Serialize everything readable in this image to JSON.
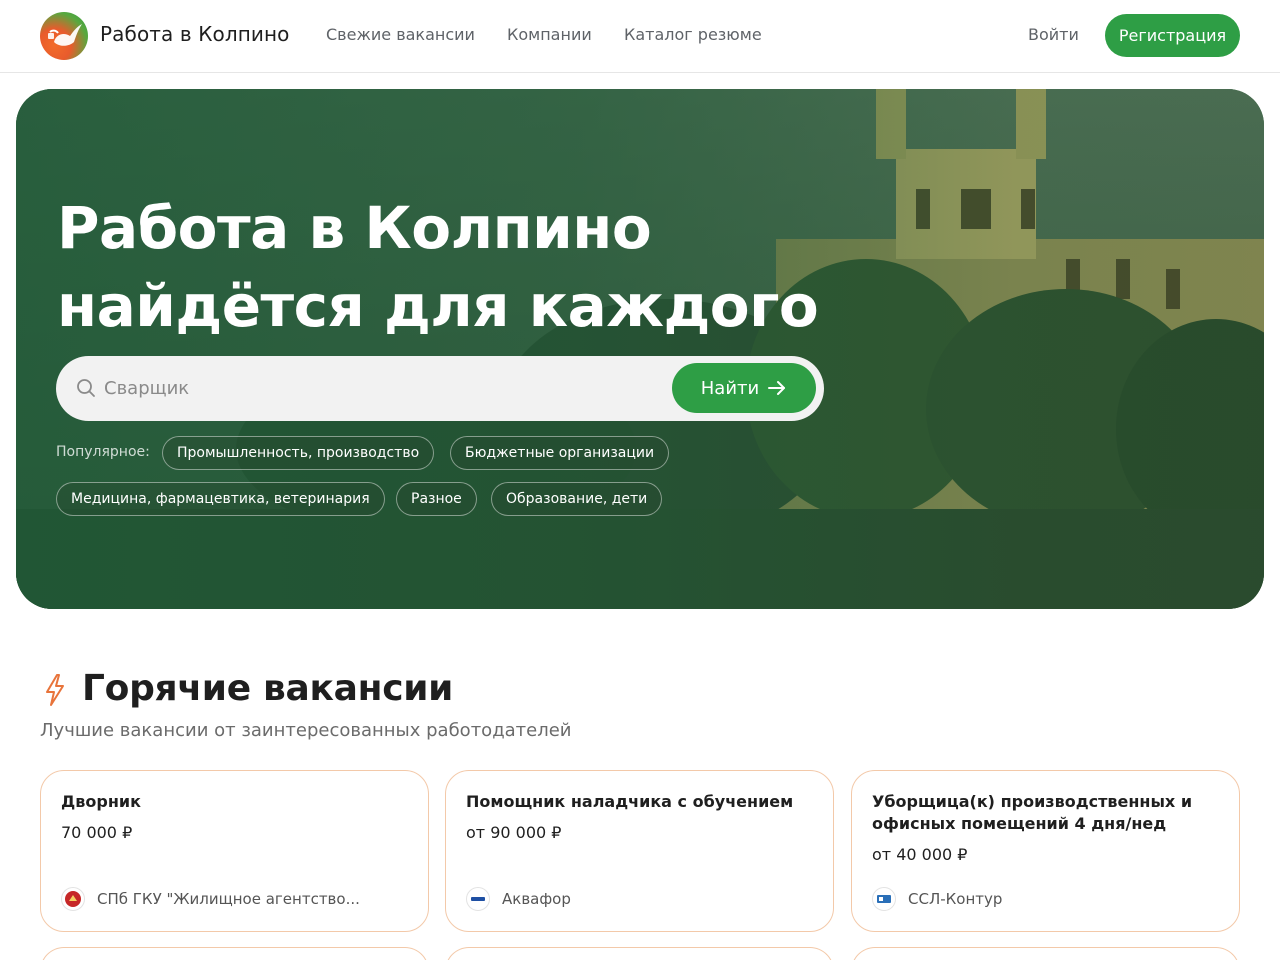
{
  "header": {
    "brand": "Работа в Колпино",
    "nav": [
      "Свежие вакансии",
      "Компании",
      "Каталог резюме"
    ],
    "login": "Войти",
    "register": "Регистрация"
  },
  "hero": {
    "title_line1": "Работа в Колпино",
    "title_line2": "найдётся для каждого",
    "search_placeholder": "Сварщик",
    "search_button": "Найти",
    "popular_label": "Популярное:",
    "chips": [
      "Промышленность, производство",
      "Бюджетные организации",
      "Медицина, фармацевтика, ветеринария",
      "Разное",
      "Образование, дети"
    ]
  },
  "hot": {
    "title": "Горячие вакансии",
    "subtitle": "Лучшие вакансии от заинтересованных работодателей",
    "cards": [
      {
        "title": "Дворник",
        "salary": "70 000 ₽",
        "company": "СПб ГКУ \"Жилищное агентство..."
      },
      {
        "title": "Помощник наладчика с обучением",
        "salary": "от 90 000 ₽",
        "company": "Аквафор"
      },
      {
        "title": "Уборщица(к) производственных и офисных помещений 4 дня/нед",
        "salary": "от 40 000 ₽",
        "company": "ССЛ-Контур"
      }
    ]
  },
  "colors": {
    "accent_green": "#2e9e45",
    "hot_orange": "#e8743b",
    "card_border": "#f3c9a9"
  },
  "icons": [
    "logo-swan-icon",
    "search-icon",
    "arrow-right-icon",
    "lightning-icon"
  ]
}
